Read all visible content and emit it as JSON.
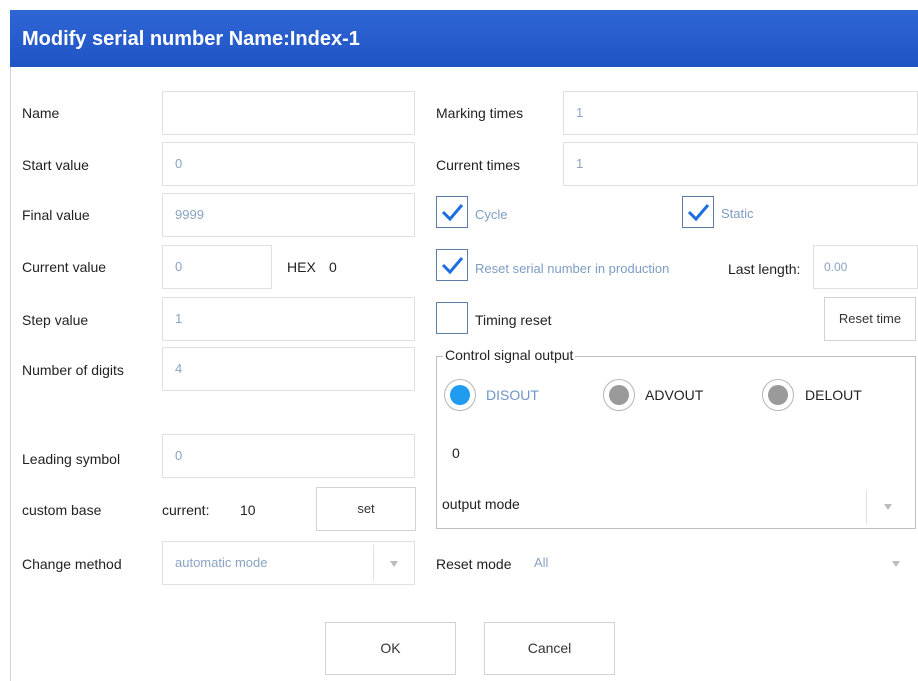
{
  "dialog": {
    "title": "Modify serial number Name:Index-1"
  },
  "left": {
    "name": {
      "label": "Name",
      "value": ""
    },
    "start_value": {
      "label": "Start value",
      "value": "0"
    },
    "final_value": {
      "label": "Final value",
      "value": "9999"
    },
    "current_value": {
      "label": "Current  value",
      "value": "0",
      "hex_label": "HEX",
      "hex_value": "0"
    },
    "step_value": {
      "label": "Step value",
      "value": "1"
    },
    "number_of_digits": {
      "label": "Number of digits",
      "value": "4"
    },
    "leading_symbol": {
      "label": "Leading symbol",
      "value": "0"
    },
    "custom_base": {
      "label": "custom base",
      "current_label": "current:",
      "current_value": "10",
      "set_button": "set"
    },
    "change_method": {
      "label": "Change method",
      "selected": "automatic mode"
    }
  },
  "right": {
    "marking_times": {
      "label": "Marking times",
      "value": "1"
    },
    "current_times": {
      "label": "Current times",
      "value": "1"
    },
    "cycle": {
      "label": "Cycle",
      "checked": true
    },
    "static": {
      "label": "Static",
      "checked": true
    },
    "reset_in_production": {
      "label": "Reset serial number in production",
      "checked": true
    },
    "last_length": {
      "label": "Last length:",
      "value": "0.00"
    },
    "timing_reset": {
      "label": "Timing reset",
      "checked": false
    },
    "reset_time_button": "Reset time",
    "control_signal": {
      "legend": "Control signal output",
      "options": [
        {
          "label": "DISOUT",
          "selected": true
        },
        {
          "label": "ADVOUT",
          "selected": false
        },
        {
          "label": "DELOUT",
          "selected": false
        }
      ],
      "value": "0",
      "output_mode_label": "output mode",
      "output_mode_selected": ""
    },
    "reset_mode": {
      "label": "Reset mode",
      "selected": "All"
    }
  },
  "footer": {
    "ok": "OK",
    "cancel": "Cancel"
  },
  "colors": {
    "titlebar": "#1f53c4",
    "radio_selected": "#1f9cf0",
    "value_text": "#8aa3c2",
    "check_mark": "#1e6ee0"
  }
}
